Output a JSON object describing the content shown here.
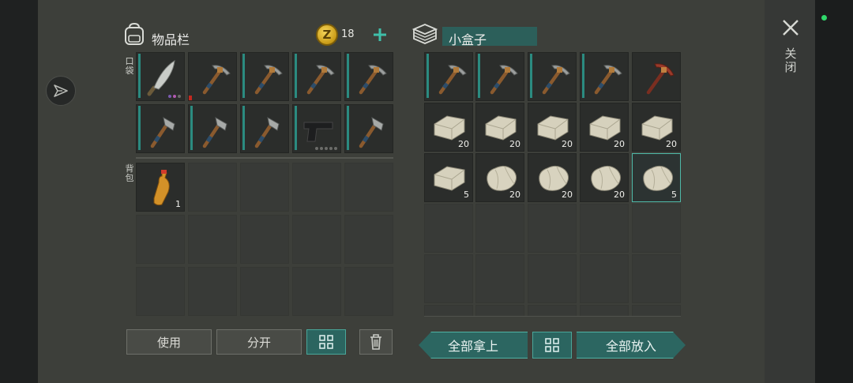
{
  "inventory": {
    "title": "物品栏",
    "currency_symbol": "Z",
    "currency_count": "18",
    "pocket_label": "口袋",
    "backpack_label": "背包",
    "pocket_slots": [
      {
        "icon": "machete-icon"
      },
      {
        "icon": "pickaxe-icon"
      },
      {
        "icon": "pickaxe-icon"
      },
      {
        "icon": "pickaxe-icon"
      },
      {
        "icon": "pickaxe-icon"
      },
      {
        "icon": "axe-icon"
      },
      {
        "icon": "axe-icon"
      },
      {
        "icon": "axe-icon"
      },
      {
        "icon": "pistol-icon"
      },
      {
        "icon": "axe-icon"
      }
    ],
    "backpack_slots": [
      {
        "icon": "bottle-icon",
        "qty": "1"
      }
    ]
  },
  "box": {
    "title": "小盒子",
    "slots": [
      {
        "icon": "pickaxe-icon"
      },
      {
        "icon": "pickaxe-icon"
      },
      {
        "icon": "pickaxe-icon"
      },
      {
        "icon": "pickaxe-icon"
      },
      {
        "icon": "red-pickaxe-icon"
      },
      {
        "icon": "stone-block-icon",
        "qty": "20"
      },
      {
        "icon": "stone-block-icon",
        "qty": "20"
      },
      {
        "icon": "stone-block-icon",
        "qty": "20"
      },
      {
        "icon": "stone-block-icon",
        "qty": "20"
      },
      {
        "icon": "stone-block-icon",
        "qty": "20"
      },
      {
        "icon": "stone-block-icon",
        "qty": "5"
      },
      {
        "icon": "rock-icon",
        "qty": "20"
      },
      {
        "icon": "rock-icon",
        "qty": "20"
      },
      {
        "icon": "rock-icon",
        "qty": "20"
      },
      {
        "icon": "rock-icon",
        "qty": "5"
      }
    ]
  },
  "buttons": {
    "use": "使用",
    "split": "分开",
    "take_all": "全部拿上",
    "put_all": "全部放入"
  },
  "close_label": "关闭",
  "colors": {
    "accent": "#2b6560",
    "panel": "#3d3f3a",
    "durability": "#2b8b80"
  }
}
